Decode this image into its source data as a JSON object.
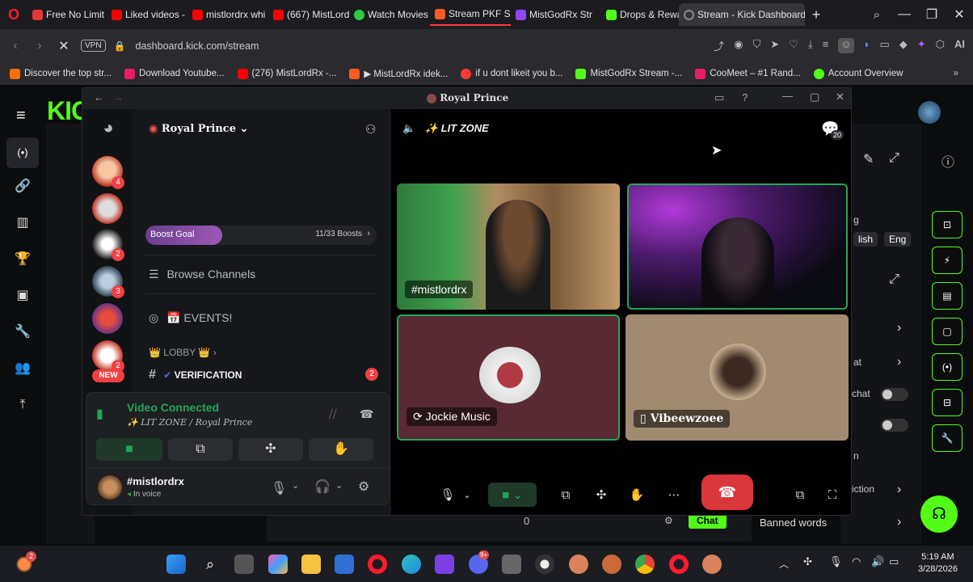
{
  "tabs": [
    {
      "label": "Free No Limit",
      "color": "#e53935"
    },
    {
      "label": "Liked videos -",
      "color": "#ff0000"
    },
    {
      "label": "mistlordrx whi",
      "color": "#ff0000"
    },
    {
      "label": "(667) MistLord",
      "color": "#ff0000"
    },
    {
      "label": "Watch Movies",
      "color": "#2ecc40"
    },
    {
      "label": "Stream PKF S",
      "color": "#ff5a1f"
    },
    {
      "label": "MistGodRx Str",
      "color": "#9146ff"
    },
    {
      "label": "Drops & Rewa",
      "color": "#53fc18"
    },
    {
      "label": "Stream - Kick Dashboard",
      "color": "#53fc18"
    }
  ],
  "address": {
    "vpn": "VPN",
    "url": "dashboard.kick.com/stream",
    "ai": "AI"
  },
  "bookmarks": [
    {
      "label": "Discover the top str...",
      "color": "#ff6f00"
    },
    {
      "label": "Download Youtube...",
      "color": "#e91e63"
    },
    {
      "label": "(276) MistLordRx -...",
      "color": "#ff0000"
    },
    {
      "label": "▶ MistLordRx idek...",
      "color": "#ff5a1f"
    },
    {
      "label": "if u dont likeit you b...",
      "color": "#ff3b30"
    },
    {
      "label": "MistGodRx Stream -...",
      "color": "#53fc18"
    },
    {
      "label": "CooMeet – #1 Rand...",
      "color": "#e91e63"
    },
    {
      "label": "Account Overview",
      "color": "#53fc18"
    }
  ],
  "kick": {
    "logo": "KIC",
    "panel_items": [
      "g",
      "lish",
      "Eng",
      "at",
      "chat",
      "n",
      "iction"
    ],
    "chat_count": "0",
    "chat_button": "Chat",
    "banned_words": "Banned words"
  },
  "discord": {
    "window_title": "Royal Prince",
    "server_name": "Royal Prince",
    "server_badges": [
      "4",
      "2",
      "3",
      "2"
    ],
    "new_badge": "NEW",
    "boost_goal": "Boost Goal",
    "boost_progress": "11/33 Boosts",
    "boost_fraction": 0.333,
    "browse_channels": "Browse Channels",
    "events": "📅 EVENTS!",
    "lobby": "👑 LOBBY 👑",
    "verification": "VERIFICATION",
    "verification_badge": "2",
    "voice_status": "Video Connected",
    "voice_channel": "LIT ZONE / Royal Prince",
    "username": "#mistlordrx",
    "user_status": "In voice",
    "channel_title": "LIT ZONE",
    "member_count": "20",
    "tiles": [
      {
        "label": "#mistlordrx"
      },
      {
        "label": ""
      },
      {
        "label": "Jockie Music"
      },
      {
        "label": "Vibeewzoee"
      }
    ]
  },
  "taskbar": {
    "time": "5:19 AM",
    "date": "3/28/2026",
    "notif_badge": "2",
    "discord_badge": "9+"
  },
  "colors": {
    "kick_green": "#53fc18",
    "discord_blurple": "#5865f2",
    "hangup_red": "#da373c",
    "boost_purple": "#9b59b6",
    "connected_green": "#23a55a"
  }
}
